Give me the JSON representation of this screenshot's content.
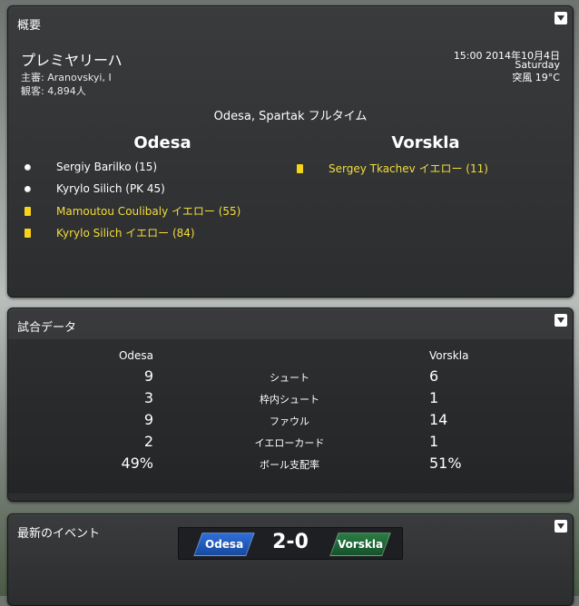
{
  "overview": {
    "title": "概要",
    "competition": "プレミヤリーハ",
    "referee": "主審: Aranovskyi, I",
    "attendance": "観客: 4,894人",
    "datetime": "15:00  2014年10月4日",
    "weekday": "Saturday",
    "weather": "突風 19°C",
    "venue": "Odesa, Spartak フルタイム",
    "home_team": "Odesa",
    "away_team": "Vorskla",
    "home_events": [
      {
        "icon": "ball-icon",
        "text": "Sergiy Barilko (15)",
        "kind": "goal"
      },
      {
        "icon": "ball-icon",
        "text": "Kyrylo Silich (PK 45)",
        "kind": "goal"
      },
      {
        "icon": "yellow-card-icon",
        "text": "Mamoutou Coulibaly イエロー (55)",
        "kind": "card"
      },
      {
        "icon": "yellow-card-icon",
        "text": "Kyrylo Silich イエロー (84)",
        "kind": "card"
      }
    ],
    "away_events": [
      {
        "icon": "yellow-card-icon",
        "text": "Sergey Tkachev イエロー (11)",
        "kind": "card"
      }
    ]
  },
  "stats": {
    "title": "試合データ",
    "home_label": "Odesa",
    "away_label": "Vorskla",
    "rows": [
      {
        "name": "シュート",
        "home": "9",
        "away": "6"
      },
      {
        "name": "枠内シュート",
        "home": "3",
        "away": "1"
      },
      {
        "name": "ファウル",
        "home": "9",
        "away": "14"
      },
      {
        "name": "イエローカード",
        "home": "2",
        "away": "1"
      },
      {
        "name": "ボール支配率",
        "home": "49%",
        "away": "51%"
      }
    ]
  },
  "latest": {
    "title": "最新のイベント",
    "home_team": "Odesa",
    "away_team": "Vorskla",
    "score": "2-0"
  },
  "colors": {
    "card_text": "#f3dd3b",
    "home_badge": "#2f6ed8",
    "away_badge": "#2a7d43"
  }
}
